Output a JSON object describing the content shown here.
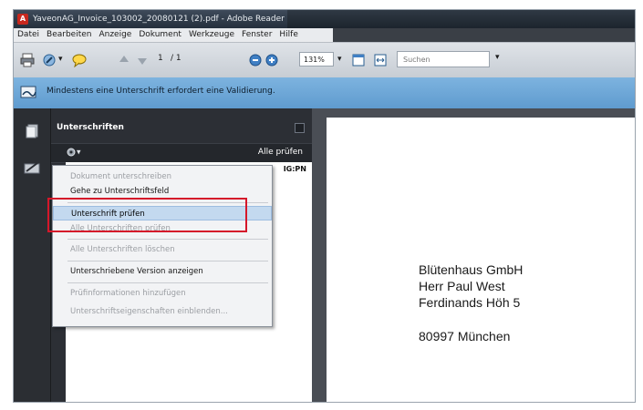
{
  "window": {
    "title": "YaveonAG_Invoice_103002_20080121 (2).pdf - Adobe Reader"
  },
  "menubar": {
    "items": [
      "Datei",
      "Bearbeiten",
      "Anzeige",
      "Dokument",
      "Werkzeuge",
      "Fenster",
      "Hilfe"
    ]
  },
  "toolbar": {
    "page_current": "1",
    "page_total": "/ 1",
    "zoom": "131%",
    "search_placeholder": "Suchen"
  },
  "infobar": {
    "message": "Mindestens eine Unterschrift erfordert eine Validierung."
  },
  "panel": {
    "title": "Unterschriften",
    "verify_all": "Alle prüfen",
    "signature_id": "IG:PN"
  },
  "dropdown": {
    "items": [
      {
        "label": "Dokument unterschreiben",
        "state": "disabled"
      },
      {
        "label": "Gehe zu Unterschriftsfeld",
        "state": "enabled"
      },
      {
        "label": "Unterschrift prüfen",
        "state": "highlight"
      },
      {
        "label": "Alle Unterschriften prüfen",
        "state": "disabled"
      },
      {
        "label": "Alle Unterschriften löschen",
        "state": "disabled"
      },
      {
        "label": "Unterschriebene Version anzeigen",
        "state": "enabled"
      },
      {
        "label": "Prüfinformationen hinzufügen",
        "state": "disabled"
      },
      {
        "label": "Unterschriftseigenschaften einblenden...",
        "state": "disabled"
      }
    ]
  },
  "document": {
    "address_lines": [
      "Blütenhaus GmbH",
      "Herr Paul West",
      "Ferdinands Höh 5",
      "80997 München"
    ]
  },
  "colors": {
    "info_bar": "#6fa7d8",
    "highlight_box": "#d5172a",
    "panel_bg": "#2c2f35"
  }
}
